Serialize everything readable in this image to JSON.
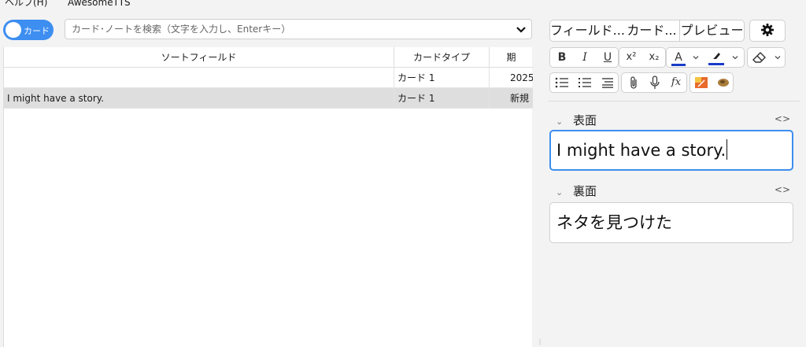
{
  "menubar": {
    "help": "ヘルプ(H)",
    "awesometts": "AwesomeTTS"
  },
  "toggle": {
    "label": "カード"
  },
  "search": {
    "placeholder": "カード･ノートを検索（文字を入力し、Enterキー）"
  },
  "table": {
    "columns": [
      "ソートフィールド",
      "カードタイプ",
      "期"
    ],
    "rows": [
      {
        "sort_field": "",
        "card_type": "カード 1",
        "due": "2025",
        "selected": false
      },
      {
        "sort_field": "I might have a story.",
        "card_type": "カード 1",
        "due": "新規",
        "selected": true
      }
    ]
  },
  "editor_toolbar": {
    "fields_button": "フィールド...",
    "cards_button": "カード...",
    "preview_button": "プレビュー",
    "bold": "B",
    "italic": "I",
    "underline": "U",
    "superscript": "x²",
    "subscript": "x₂",
    "text_color_letter": "A",
    "function": "fx"
  },
  "colors": {
    "accent": "#3d8ef0",
    "text_color": "#1a3cc8",
    "highlight_color": "#1a3cc8"
  },
  "fields": [
    {
      "name": "表面",
      "value": "I might have a story.",
      "focused": true
    },
    {
      "name": "裏面",
      "value": "ネタを見つけた",
      "focused": false
    }
  ],
  "html_toggle_symbol": "<>"
}
